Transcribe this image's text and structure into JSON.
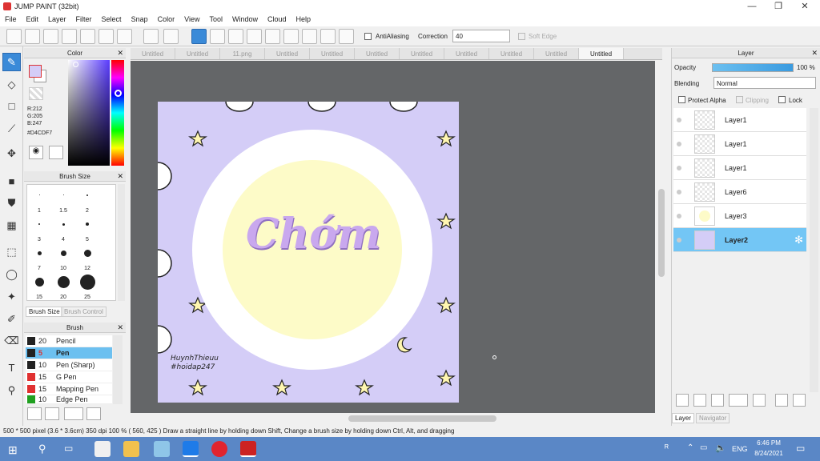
{
  "window": {
    "title": "JUMP PAINT (32bit)"
  },
  "menu": [
    "File",
    "Edit",
    "Layer",
    "Filter",
    "Select",
    "Snap",
    "Color",
    "View",
    "Tool",
    "Window",
    "Cloud",
    "Help"
  ],
  "toolbar": {
    "antialias_label": "AntiAliasing",
    "correction_label": "Correction",
    "correction_value": "40",
    "softedge_label": "Soft Edge"
  },
  "color_panel": {
    "title": "Color",
    "r": "R:212",
    "g": "G:205",
    "b": "B:247",
    "hex": "#D4CDF7"
  },
  "brush_size_panel": {
    "title": "Brush Size",
    "sizes": [
      "1",
      "1.5",
      "2",
      "3",
      "4",
      "5",
      "7",
      "10",
      "12",
      "15",
      "20",
      "25"
    ],
    "tab_active": "Brush Size",
    "tab_inactive": "Brush Control"
  },
  "brush_panel": {
    "title": "Brush",
    "items": [
      {
        "size": "20",
        "name": "Pencil",
        "color": "#222222"
      },
      {
        "size": "5",
        "name": "Pen",
        "color": "#222222"
      },
      {
        "size": "10",
        "name": "Pen (Sharp)",
        "color": "#222222"
      },
      {
        "size": "15",
        "name": "G Pen",
        "color": "#e03030"
      },
      {
        "size": "15",
        "name": "Mapping Pen",
        "color": "#e03030"
      },
      {
        "size": "10",
        "name": "Edge Pen",
        "color": "#20a020"
      }
    ]
  },
  "tabs": [
    "Untitled",
    "Untitled",
    "11.png",
    "Untitled",
    "Untitled",
    "Untitled",
    "Untitled",
    "Untitled",
    "Untitled",
    "Untitled",
    "Untitled"
  ],
  "canvas": {
    "title_text": "Chớm",
    "signature_line1": "HuynhThieuu",
    "signature_line2": "#hoidap247"
  },
  "layer_panel": {
    "title": "Layer",
    "opacity_label": "Opacity",
    "opacity_value": "100 %",
    "blending_label": "Blending",
    "blending_value": "Normal",
    "protect_alpha": "Protect Alpha",
    "clipping": "Clipping",
    "lock": "Lock",
    "layers": [
      "Layer1",
      "Layer1",
      "Layer1",
      "Layer6",
      "Layer3",
      "Layer2"
    ],
    "tab_active": "Layer",
    "tab_inactive": "Navigator"
  },
  "status": {
    "text": "500 * 500 pixel  (3.6 * 3.6cm)  350 dpi  100 %  ( 560, 425 )  Draw a straight line by holding down Shift, Change a brush size by holding down Ctrl, Alt, and dragging"
  },
  "taskbar": {
    "lang": "ENG",
    "time": "6:46 PM",
    "date": "8/24/2021"
  }
}
